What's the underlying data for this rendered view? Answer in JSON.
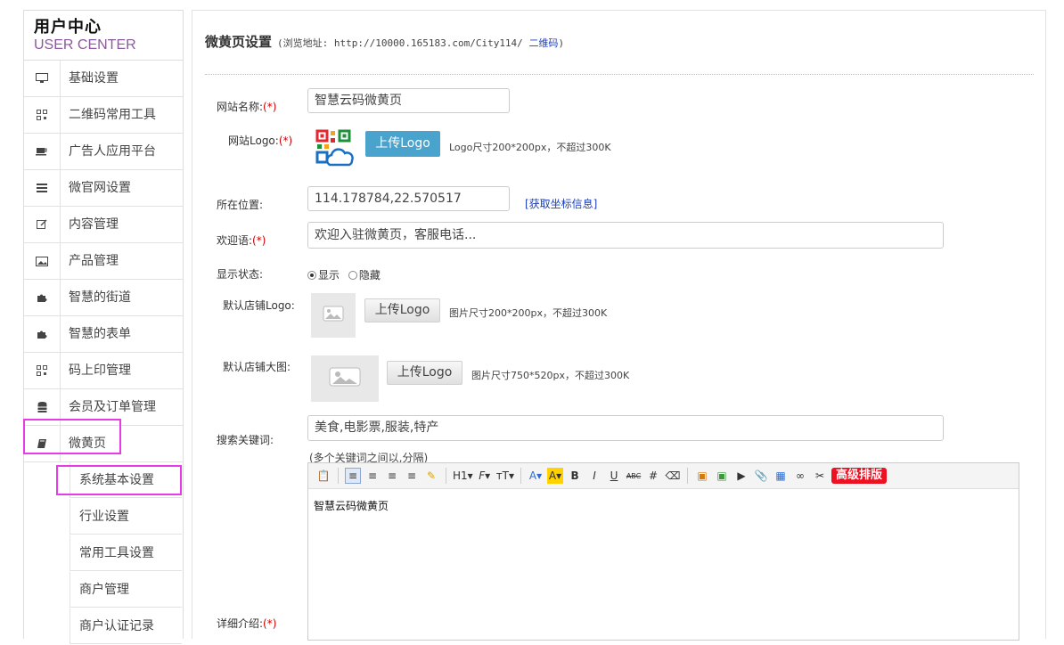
{
  "sidebar": {
    "title": "用户中心",
    "subtitle": "USER CENTER",
    "items": [
      {
        "label": "基础设置",
        "icon": "monitor-icon"
      },
      {
        "label": "二维码常用工具",
        "icon": "qrcode-icon"
      },
      {
        "label": "广告人应用平台",
        "icon": "coffee-icon"
      },
      {
        "label": "微官网设置",
        "icon": "list-icon"
      },
      {
        "label": "内容管理",
        "icon": "edit-icon"
      },
      {
        "label": "产品管理",
        "icon": "image-icon"
      },
      {
        "label": "智慧的街道",
        "icon": "puzzle-icon"
      },
      {
        "label": "智慧的表单",
        "icon": "puzzle-icon"
      },
      {
        "label": "码上印管理",
        "icon": "qrcode-icon"
      },
      {
        "label": "会员及订单管理",
        "icon": "database-icon"
      },
      {
        "label": "微黄页",
        "icon": "book-icon"
      }
    ],
    "subitems": [
      "系统基本设置",
      "行业设置",
      "常用工具设置",
      "商户管理",
      "商户认证记录"
    ]
  },
  "header": {
    "title": "微黄页设置",
    "addr_prefix": "(浏览地址: http://10000.165183.com/City114/ ",
    "qr_link": "二维码",
    "addr_suffix": ")"
  },
  "form": {
    "site_name_label": "网站名称:",
    "site_name_value": "智慧云码微黄页",
    "logo_label": "网站Logo:",
    "upload_logo": "上传Logo",
    "logo_hint": "Logo尺寸200*200px，不超过300K",
    "location_label": "所在位置:",
    "location_value": "114.178784,22.570517",
    "get_coords": "[获取坐标信息]",
    "welcome_label": "欢迎语:",
    "welcome_placeholder": "欢迎入驻微黄页，客服电话...",
    "status_label": "显示状态:",
    "status_show": "显示",
    "status_hide": "隐藏",
    "default_logo_label": "默认店铺Logo:",
    "default_logo_hint": "图片尺寸200*200px，不超过300K",
    "default_banner_label": "默认店铺大图:",
    "default_banner_hint": "图片尺寸750*520px，不超过300K",
    "keywords_label": "搜索关键词:",
    "keywords_value": "美食,电影票,服装,特产",
    "keywords_hint": "(多个关键词之间以,分隔)",
    "detail_label": "详细介绍:",
    "detail_content": "智慧云码微黄页",
    "required_mark": "(*)",
    "advanced": "高级排版"
  }
}
